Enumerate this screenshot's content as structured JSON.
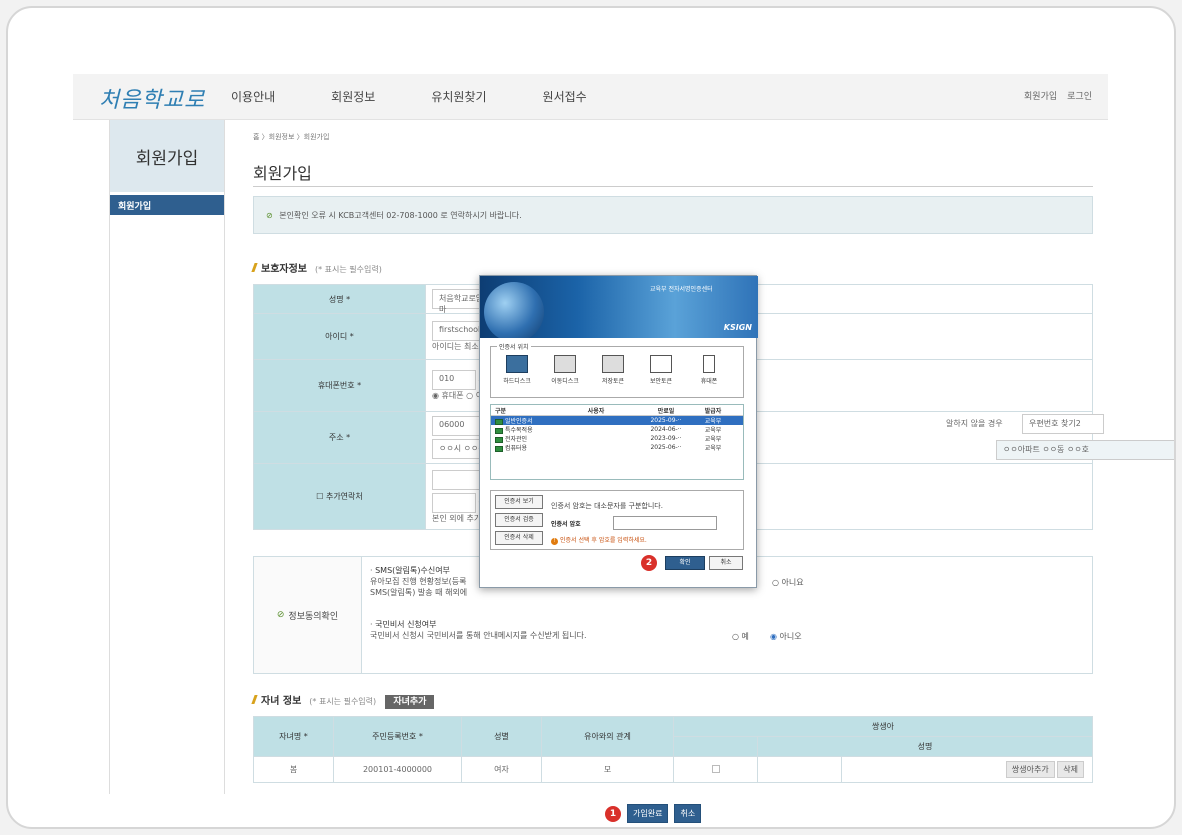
{
  "header": {
    "logo": "처음학교로",
    "nav": [
      "이용안내",
      "회원정보",
      "유치원찾기",
      "원서접수"
    ],
    "links": [
      "회원가입",
      "로그인"
    ]
  },
  "sidebar": {
    "title": "회원가입",
    "items": [
      {
        "label": "회원가입"
      }
    ]
  },
  "main": {
    "breadcrumb": "홈 〉회원정보 〉회원가입",
    "title": "회원가입",
    "notice": "본인확인 오류 시 KCB고객센터 02-708-1000 로 연락하시기 바랍니다."
  },
  "guardian": {
    "section_title": "보호자정보",
    "section_note": "(* 표시는 필수입력)",
    "name_label": "성명",
    "name_value": "처음학교로엄마",
    "id_label": "아이디",
    "id_value": "firstschool20",
    "id_hint": "아이디는 최소 6",
    "phone_label": "휴대폰번호",
    "phone_prefix": "010",
    "phone_radio_mobile": "휴대폰",
    "phone_radio_other": "이",
    "address_label": "주소",
    "zip_value": "06000",
    "address_value": "ㅇㅇ시 ㅇㅇ구",
    "address_partial_note": "알하지 않을 경우",
    "zip_search2": "우편번호 찾기2",
    "detail_address": "ㅇㅇ아파트 ㅇㅇ동 ㅇㅇ호",
    "extra_contact_label": "추가연락처",
    "extra_contact_note": "본인 외에 추가로"
  },
  "consent": {
    "label": "정보동의확인",
    "sms_title": "SMS(알림톡)수신여부",
    "sms_desc1": "유아모집 진행 현황정보(등록",
    "sms_desc2": "SMS(알림톡) 발송 때 해외에",
    "sms_no": "아니요",
    "mail_title": "국민비서 신청여부",
    "mail_desc": "국민비서 신청시 국민비서를 통해 안내메시지를 수신받게 됩니다.",
    "mail_yes": "예",
    "mail_no": "아니오"
  },
  "children": {
    "section_title": "자녀 정보",
    "section_note": "(* 표시는 필수입력)",
    "add_button": "자녀추가",
    "headers": {
      "name": "자녀명",
      "rrn": "주민등록번호",
      "gender": "성별",
      "relation": "유아와의 관계",
      "twin": "쌍생아",
      "twin_name": "성명"
    },
    "rows": [
      {
        "name": "봄",
        "rrn": "200101-4000000",
        "gender": "여자",
        "relation": "모"
      }
    ],
    "twin_add_button": "쌍생아추가",
    "delete_button": "삭제"
  },
  "bottom": {
    "badge1": "1",
    "submit_button": "가입완료",
    "cancel_button": "취소"
  },
  "modal": {
    "org": "교육부 전자서명인증센터",
    "brand": "KSIGN",
    "location_legend": "인증서 위치",
    "locations": [
      "하드디스크",
      "이동디스크",
      "저장토큰",
      "보안토큰",
      "휴대폰"
    ],
    "table_headers": [
      "구분",
      "사용자",
      "만료일",
      "발급자"
    ],
    "certs": [
      {
        "type": "일반인증서",
        "user": "",
        "expiry": "2025-09-··",
        "issuer": "교육부"
      },
      {
        "type": "특수목적용",
        "user": "",
        "expiry": "2024-06-··",
        "issuer": "교육부"
      },
      {
        "type": "전자관인",
        "user": "",
        "expiry": "2023-09-··",
        "issuer": "교육부"
      },
      {
        "type": "컴퓨터용",
        "user": "",
        "expiry": "2025-06-··",
        "issuer": "교육부"
      }
    ],
    "view_button": "인증서 보기",
    "verify_button": "인증서 검증",
    "delete_button": "인증서 삭제",
    "pw_hint": "인증서 암호는 대소문자를 구분합니다.",
    "pw_label": "인증서 암호",
    "pw_warning": "인증서 선택 후 암호를 입력하세요.",
    "badge2": "2",
    "ok_button": "확인",
    "cancel_button": "취소"
  }
}
